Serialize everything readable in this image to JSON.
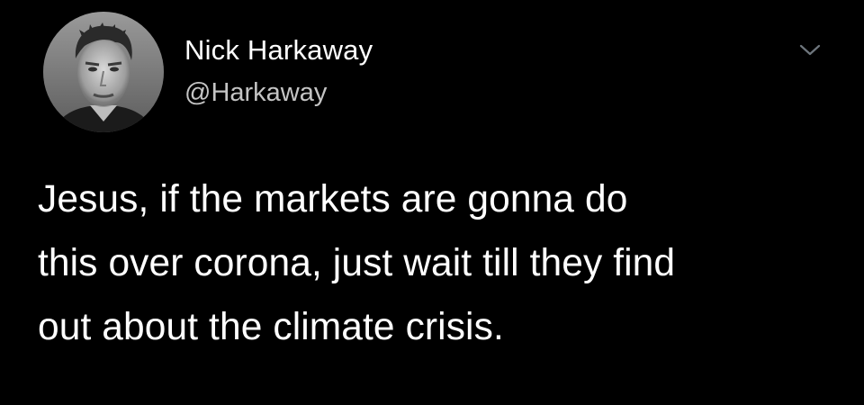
{
  "author": {
    "display_name": "Nick Harkaway",
    "handle": "@Harkaway",
    "avatar_icon": "profile-photo"
  },
  "menu": {
    "icon": "chevron-down-icon"
  },
  "tweet": {
    "lines": [
      "Jesus, if the markets are gonna do",
      "this over corona, just wait till they find",
      "out about the climate crisis."
    ]
  },
  "colors": {
    "background": "#000000",
    "name": "#ffffff",
    "handle": "#c4c4c4",
    "caret": "#6e767d"
  }
}
